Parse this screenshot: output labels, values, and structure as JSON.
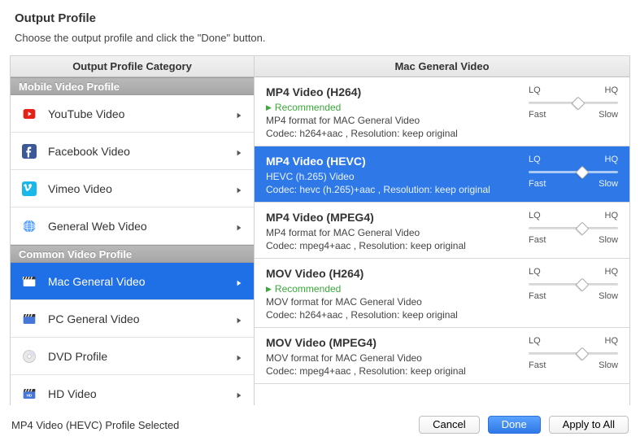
{
  "header": {
    "title": "Output Profile",
    "subtitle": "Choose the output profile and click the \"Done\" button."
  },
  "columns": {
    "left_header": "Output Profile Category",
    "right_header": "Mac General Video"
  },
  "slider_labels": {
    "lq": "LQ",
    "hq": "HQ",
    "fast": "Fast",
    "slow": "Slow"
  },
  "recommended_label": "Recommended",
  "groups": [
    {
      "id": "mobile-video-profile",
      "label": "Mobile Video Profile",
      "items": [
        {
          "id": "youtube-video",
          "label": "YouTube Video",
          "icon": "youtube"
        },
        {
          "id": "facebook-video",
          "label": "Facebook Video",
          "icon": "facebook"
        },
        {
          "id": "vimeo-video",
          "label": "Vimeo Video",
          "icon": "vimeo"
        },
        {
          "id": "general-web-video",
          "label": "General Web Video",
          "icon": "globe"
        }
      ]
    },
    {
      "id": "common-video-profile",
      "label": "Common Video Profile",
      "items": [
        {
          "id": "mac-general-video",
          "label": "Mac General Video",
          "icon": "clapperboard",
          "selected": true
        },
        {
          "id": "pc-general-video",
          "label": "PC General Video",
          "icon": "clapperboard"
        },
        {
          "id": "dvd-profile",
          "label": "DVD Profile",
          "icon": "disc"
        },
        {
          "id": "hd-video",
          "label": "HD Video",
          "icon": "clapperboard-hd"
        }
      ]
    }
  ],
  "formats": [
    {
      "id": "mp4-h264",
      "title": "MP4 Video (H264)",
      "recommended": true,
      "desc": "MP4 format for MAC General Video",
      "codec": "Codec: h264+aac , Resolution: keep original",
      "quality": 0.55
    },
    {
      "id": "mp4-hevc",
      "title": "MP4 Video (HEVC)",
      "recommended": false,
      "desc": "HEVC (h.265) Video",
      "codec": "Codec: hevc (h.265)+aac , Resolution: keep original",
      "quality": 0.6,
      "selected": true
    },
    {
      "id": "mp4-mpeg4",
      "title": "MP4 Video (MPEG4)",
      "recommended": false,
      "desc": "MP4 format for MAC General Video",
      "codec": "Codec: mpeg4+aac , Resolution: keep original",
      "quality": 0.6
    },
    {
      "id": "mov-h264",
      "title": "MOV Video (H264)",
      "recommended": true,
      "desc": "MOV format for MAC General Video",
      "codec": "Codec: h264+aac , Resolution: keep original",
      "quality": 0.6
    },
    {
      "id": "mov-mpeg4",
      "title": "MOV Video (MPEG4)",
      "recommended": false,
      "desc": "MOV format for MAC General Video",
      "codec": "Codec: mpeg4+aac , Resolution: keep original",
      "quality": 0.6
    }
  ],
  "bottom": {
    "status": "MP4 Video (HEVC) Profile Selected",
    "cancel": "Cancel",
    "done": "Done",
    "apply_all": "Apply to All"
  }
}
